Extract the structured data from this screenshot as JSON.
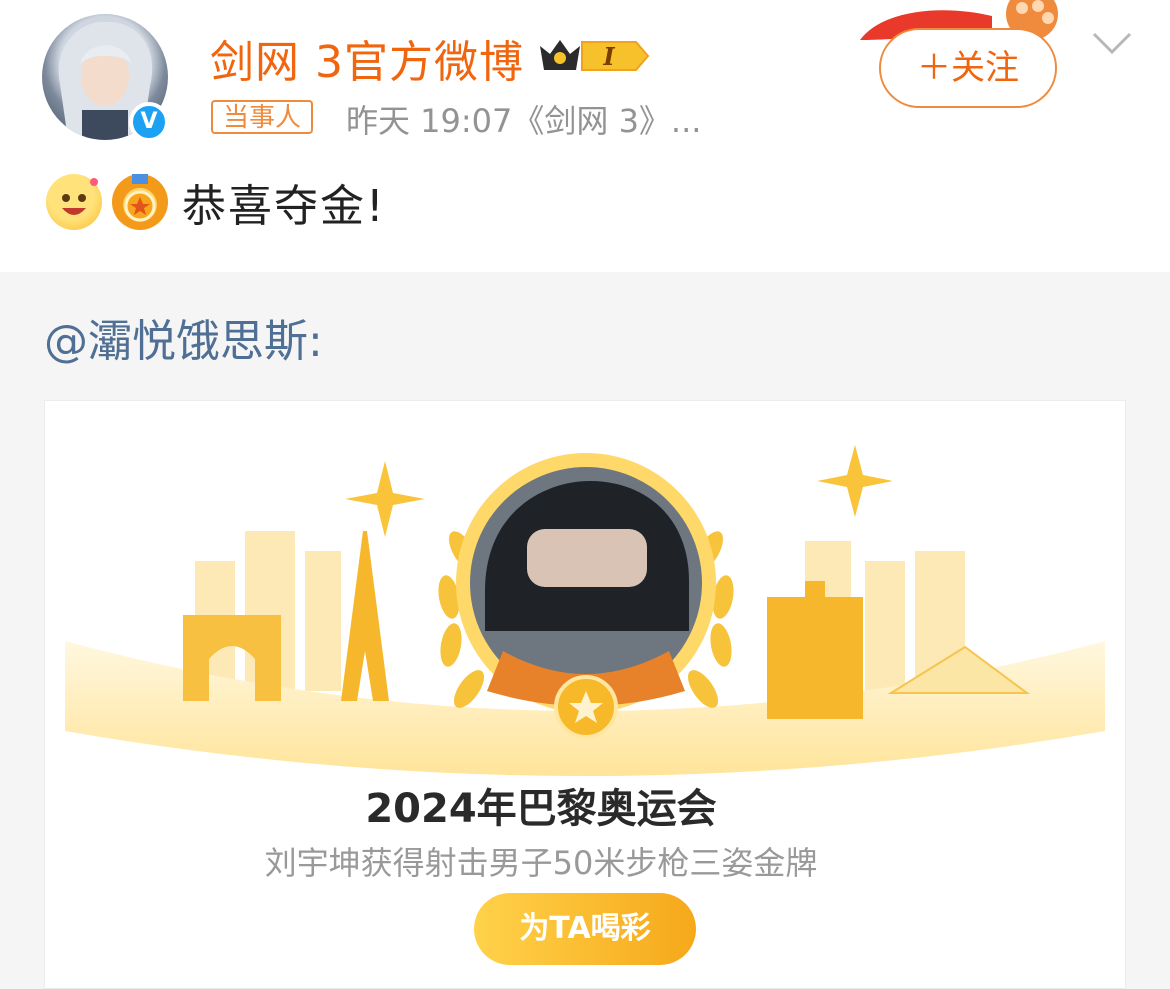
{
  "post": {
    "author_name": "剑网 3官方微博",
    "vip_badge_text": "I",
    "role_tag": "当事人",
    "meta": "昨天 19:07《剑网 3》...",
    "follow_label": "＋关注",
    "text": "恭喜夺金!",
    "icons": [
      "avatar",
      "verified-icon",
      "vip-crown-icon",
      "chevron-down-icon",
      "happy-face-emoji",
      "medal-emoji"
    ]
  },
  "repost": {
    "mention": "@灞悦饿思斯:",
    "card": {
      "title": "2024年巴黎奥运会",
      "subtitle": "刘宇坤获得射击男子50米步枪三姿金牌",
      "button_label": "为TA喝彩"
    }
  },
  "colors": {
    "accent": "#f0650e",
    "tag_border": "#f08a3c",
    "mention_link": "#4f6f94",
    "gold": "#f6c12b",
    "verified": "#1da1f2"
  }
}
